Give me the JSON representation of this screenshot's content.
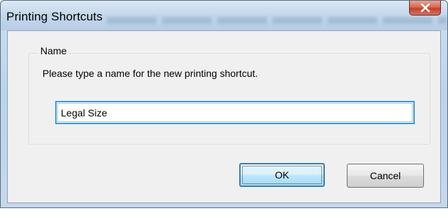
{
  "window": {
    "title": "Printing Shortcuts",
    "close_icon": "close-icon",
    "colors": {
      "focus_blue": "#3a9bd9",
      "close_red": "#c4412a"
    }
  },
  "group": {
    "legend": "Name",
    "prompt": "Please type a name for the new printing shortcut.",
    "name_value": "Legal Size"
  },
  "buttons": {
    "ok_label": "OK",
    "cancel_label": "Cancel"
  }
}
